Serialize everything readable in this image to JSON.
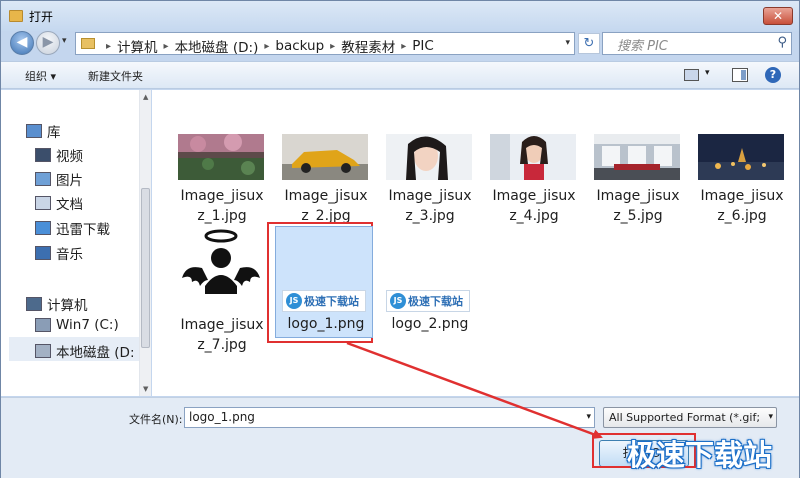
{
  "window": {
    "title": "打开",
    "close_glyph": "✕"
  },
  "nav": {
    "back_glyph": "◀",
    "forward_glyph": "▶",
    "history_glyph": "▾",
    "breadcrumbs": [
      "计算机",
      "本地磁盘 (D:)",
      "backup",
      "教程素材",
      "PIC"
    ],
    "separator": "▸",
    "refresh_glyph": "↻",
    "search_placeholder": "搜索 PIC",
    "search_glyph": "⚲"
  },
  "toolbar": {
    "organize": "组织 ▾",
    "new_folder": "新建文件夹",
    "view_drop": "▾",
    "help": "?"
  },
  "sidebar": {
    "items": [
      {
        "label": "库",
        "icon": "library-icon",
        "top": true
      },
      {
        "label": "视频",
        "icon": "video-icon"
      },
      {
        "label": "图片",
        "icon": "picture-icon"
      },
      {
        "label": "文档",
        "icon": "document-icon"
      },
      {
        "label": "迅雷下载",
        "icon": "download-icon"
      },
      {
        "label": "音乐",
        "icon": "music-icon"
      },
      {
        "label": "计算机",
        "icon": "computer-icon",
        "top": true
      },
      {
        "label": "Win7 (C:)",
        "icon": "drive-c-icon"
      },
      {
        "label": "本地磁盘 (D:",
        "icon": "drive-d-icon",
        "selected": true
      }
    ]
  },
  "files": [
    {
      "name1": "Image_jisux",
      "name2": "z_1.jpg",
      "thumb": "flowers"
    },
    {
      "name1": "Image_jisux",
      "name2": "z_2.jpg",
      "thumb": "car"
    },
    {
      "name1": "Image_jisux",
      "name2": "z_3.jpg",
      "thumb": "portrait"
    },
    {
      "name1": "Image_jisux",
      "name2": "z_4.jpg",
      "thumb": "woman"
    },
    {
      "name1": "Image_jisux",
      "name2": "z_5.jpg",
      "thumb": "room"
    },
    {
      "name1": "Image_jisux",
      "name2": "z_6.jpg",
      "thumb": "night-city"
    },
    {
      "name1": "Image_jisux",
      "name2": "z_7.jpg",
      "thumb": "angel"
    },
    {
      "name1": "logo_1.png",
      "name2": "",
      "thumb": "logo",
      "selected": true
    },
    {
      "name1": "logo_2.png",
      "name2": "",
      "thumb": "logo"
    }
  ],
  "logo_text": "极速下载站",
  "logo_badge": "JS",
  "bottom": {
    "filename_label": "文件名(N):",
    "filename_value": "logo_1.png",
    "filter_value": "All Supported Format (*.gif;*",
    "open_label": "打开(O)",
    "drop_glyph": "▾"
  },
  "watermark": "极速下载站",
  "colors": {
    "highlight": "#e03030",
    "selection": "#cde3fb"
  }
}
